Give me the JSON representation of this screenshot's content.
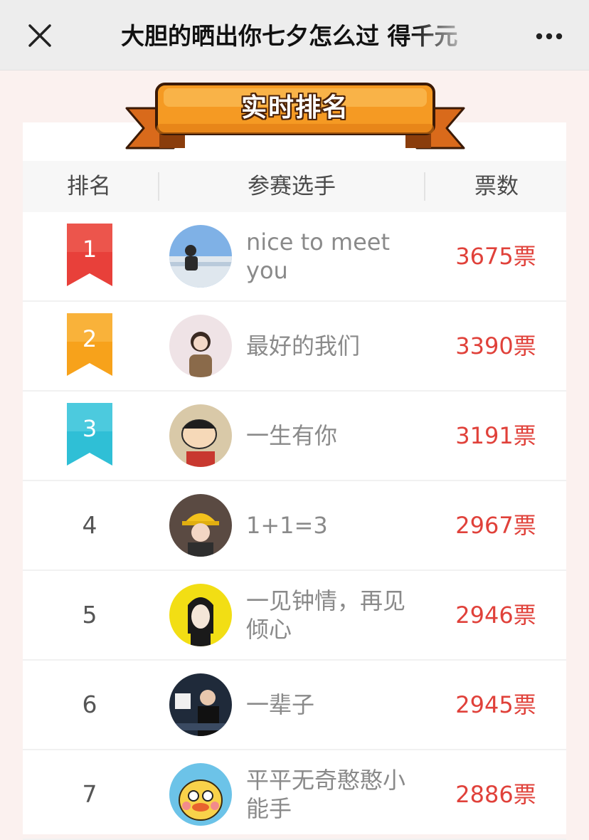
{
  "nav": {
    "title": "大胆的晒出你七夕怎么过 得千元",
    "close_icon": "close-icon",
    "more_icon": "more-dots-icon"
  },
  "banner": {
    "text": "实时排名"
  },
  "table": {
    "headers": [
      "排名",
      "参赛选手",
      "票数"
    ],
    "rows": [
      {
        "rank": "1",
        "name": "nice to meet you",
        "votes": "3675票",
        "badge_color": "#e8403a"
      },
      {
        "rank": "2",
        "name": "最好的我们",
        "votes": "3390票",
        "badge_color": "#f7a21b"
      },
      {
        "rank": "3",
        "name": "一生有你",
        "votes": "3191票",
        "badge_color": "#2fbfd6"
      },
      {
        "rank": "4",
        "name": "1+1=3",
        "votes": "2967票"
      },
      {
        "rank": "5",
        "name": "一见钟情，再见倾心",
        "votes": "2946票"
      },
      {
        "rank": "6",
        "name": "一辈子",
        "votes": "2945票"
      },
      {
        "rank": "7",
        "name": "平平无奇憨憨小能手",
        "votes": "2886票"
      }
    ]
  },
  "colors": {
    "accent": "#e0413a",
    "banner_orange": "#f59a23",
    "background": "#fbf1ef"
  }
}
